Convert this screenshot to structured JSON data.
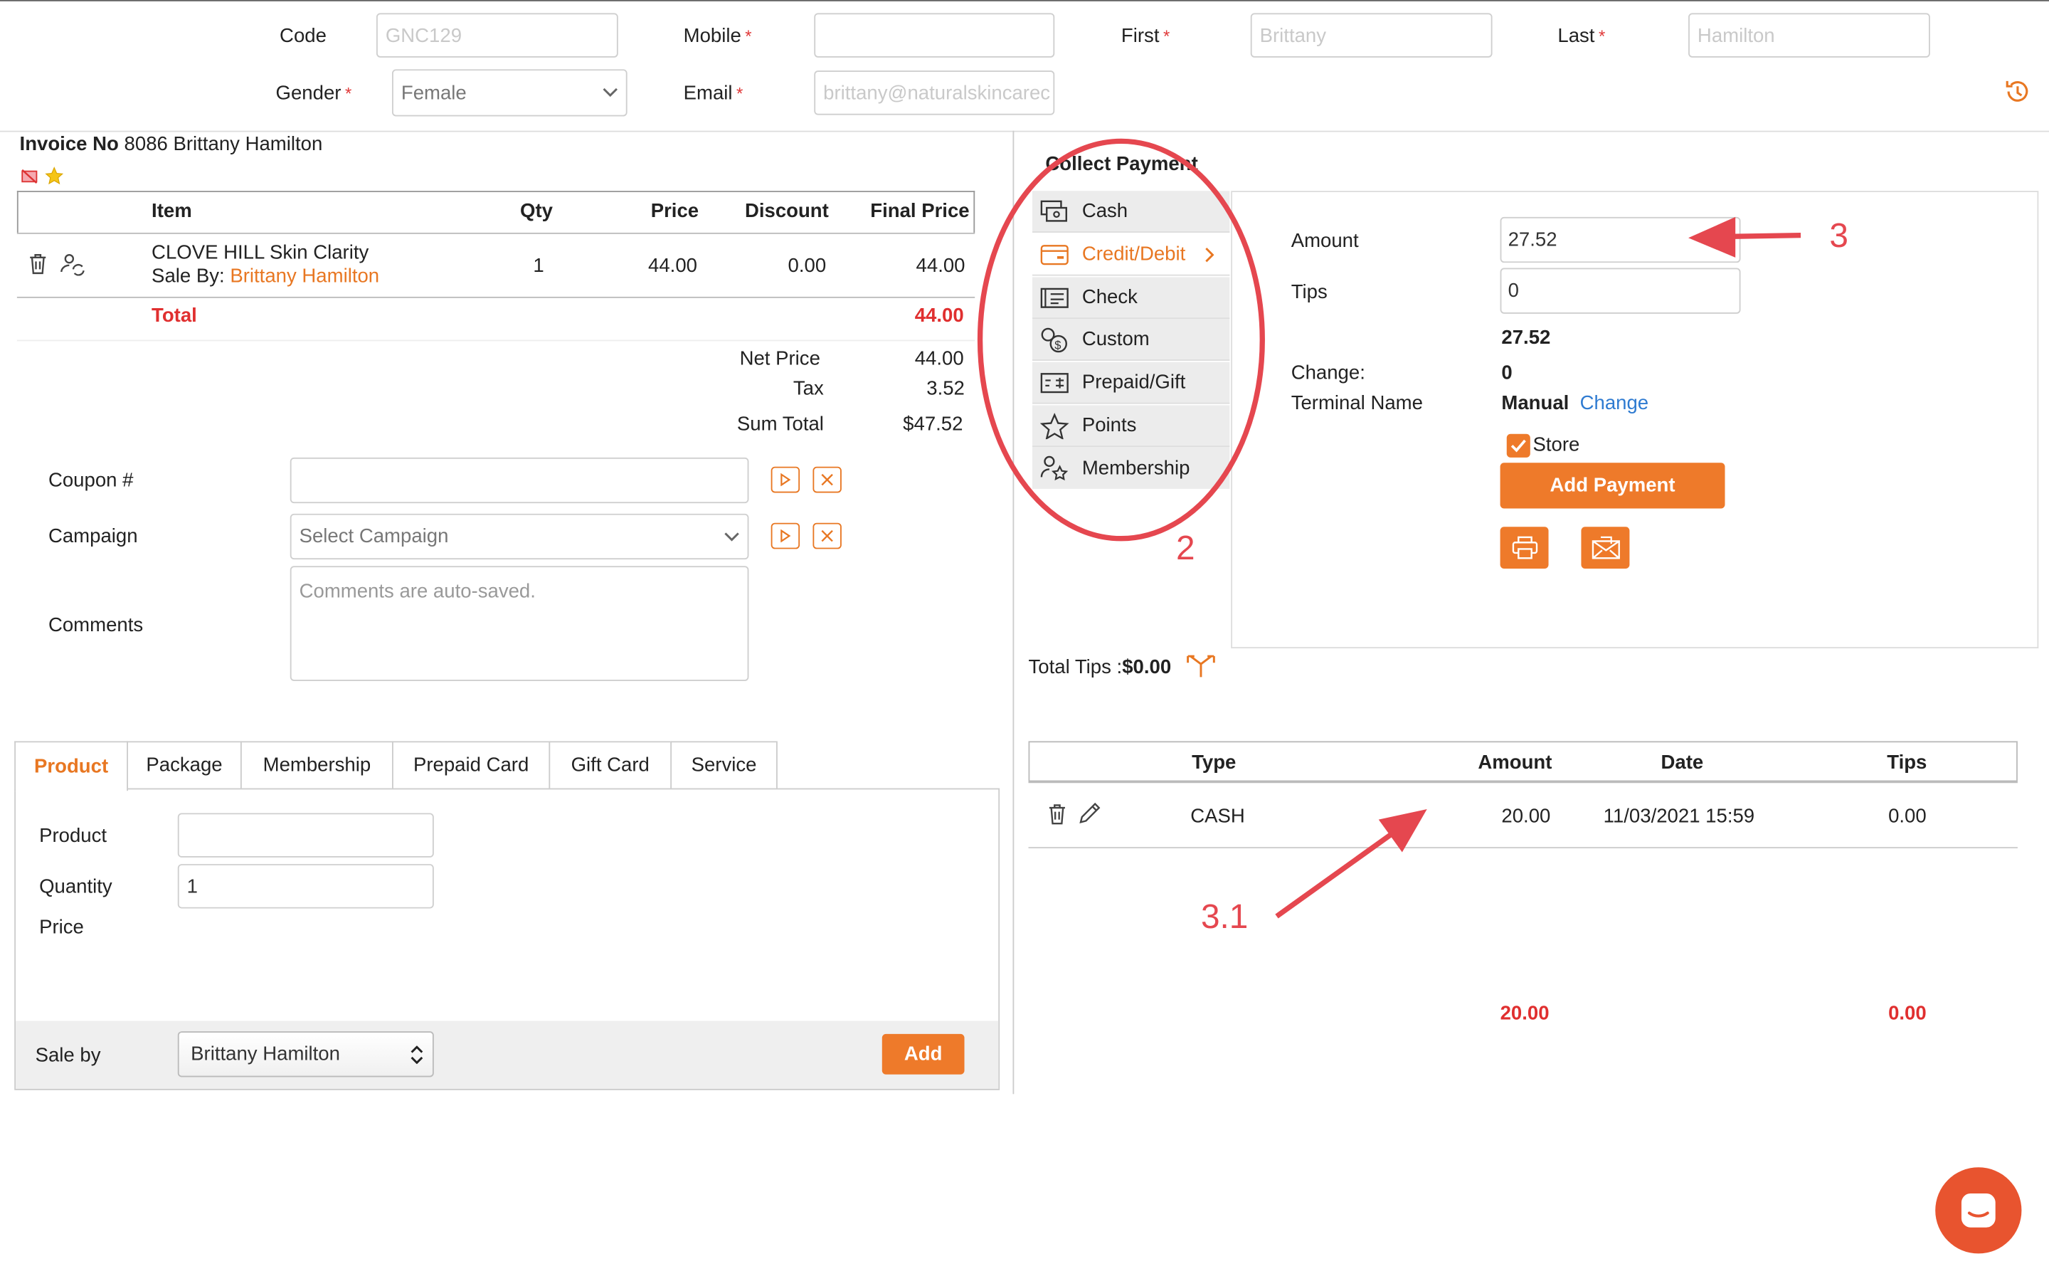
{
  "header": {
    "code_label": "Code",
    "code_value": "GNC129",
    "mobile_label": "Mobile",
    "mobile_value": "",
    "first_label": "First",
    "first_value": "Brittany",
    "last_label": "Last",
    "last_value": "Hamilton",
    "gender_label": "Gender",
    "gender_value": "Female",
    "email_label": "Email",
    "email_value": "brittany@naturalskincarec",
    "required_mark": "*"
  },
  "invoice": {
    "label": "Invoice No",
    "number": "8086",
    "customer": "Brittany Hamilton",
    "columns": [
      "Item",
      "Qty",
      "Price",
      "Discount",
      "Final Price"
    ],
    "item": {
      "name": "CLOVE HILL Skin Clarity",
      "sale_by_label": "Sale By:",
      "sale_by": "Brittany Hamilton",
      "qty": "1",
      "price": "44.00",
      "discount": "0.00",
      "final": "44.00"
    },
    "total_label": "Total",
    "total_value": "44.00",
    "net_label": "Net Price",
    "net_value": "44.00",
    "tax_label": "Tax",
    "tax_value": "3.52",
    "sum_label": "Sum Total",
    "sum_value": "$47.52"
  },
  "form": {
    "coupon_label": "Coupon #",
    "coupon_value": "",
    "campaign_label": "Campaign",
    "campaign_placeholder": "Select Campaign",
    "comments_label": "Comments",
    "comments_placeholder": "Comments are auto-saved."
  },
  "tabs": [
    "Product",
    "Package",
    "Membership",
    "Prepaid Card",
    "Gift Card",
    "Service"
  ],
  "product_panel": {
    "product_label": "Product",
    "product_value": "",
    "quantity_label": "Quantity",
    "quantity_value": "1",
    "price_label": "Price",
    "sale_by_label": "Sale by",
    "sale_by_value": "Brittany Hamilton",
    "add_label": "Add"
  },
  "payment": {
    "title": "Collect Payment",
    "methods": [
      "Cash",
      "Credit/Debit",
      "Check",
      "Custom",
      "Prepaid/Gift",
      "Points",
      "Membership"
    ],
    "amount_label": "Amount",
    "amount_value": "27.52",
    "tips_label": "Tips",
    "tips_value": "0",
    "sum_value": "27.52",
    "change_label": "Change:",
    "change_value": "0",
    "terminal_label": "Terminal Name",
    "terminal_value": "Manual",
    "terminal_change": "Change",
    "store_label": "Store",
    "add_payment_label": "Add Payment",
    "total_tips_label": "Total Tips :",
    "total_tips_value": "$0.00"
  },
  "payments_table": {
    "columns": [
      "Type",
      "Amount",
      "Date",
      "Tips"
    ],
    "rows": [
      {
        "type": "CASH",
        "amount": "20.00",
        "date": "11/03/2021 15:59",
        "tips": "0.00"
      }
    ],
    "total_amount": "20.00",
    "total_tips": "0.00"
  },
  "annotations": {
    "a2": "2",
    "a3": "3",
    "a31": "3.1"
  },
  "colors": {
    "accent": "#e87722",
    "total_red": "#e02f2f",
    "annotation_red": "#e5474f",
    "link_blue": "#2f7bd1"
  }
}
